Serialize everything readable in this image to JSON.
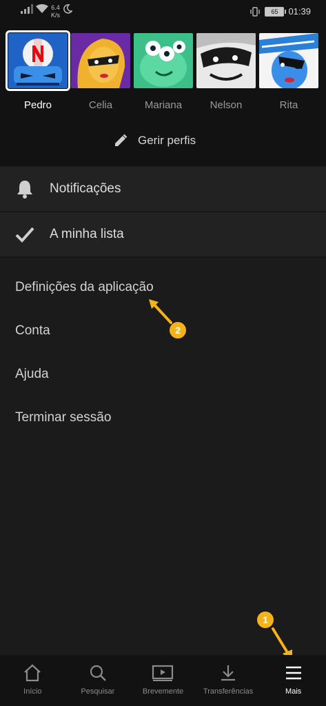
{
  "status_bar": {
    "net_speed_value": "6.4",
    "net_speed_unit": "K/s",
    "battery": "65",
    "time": "01:39"
  },
  "profiles": [
    {
      "name": "Pedro",
      "selected": true
    },
    {
      "name": "Celia",
      "selected": false
    },
    {
      "name": "Mariana",
      "selected": false
    },
    {
      "name": "Nelson",
      "selected": false
    },
    {
      "name": "Rita",
      "selected": false
    }
  ],
  "manage_profiles_label": "Gerir perfis",
  "menu": {
    "notifications_label": "Notificações",
    "my_list_label": "A minha lista"
  },
  "links": {
    "app_settings": "Definições da aplicação",
    "account": "Conta",
    "help": "Ajuda",
    "sign_out": "Terminar sessão"
  },
  "annotations": {
    "badge_1": "1",
    "badge_2": "2"
  },
  "bottom_nav": {
    "home": "Início",
    "search": "Pesquisar",
    "coming_soon": "Brevemente",
    "downloads": "Transferências",
    "more": "Mais"
  },
  "colors": {
    "accent_badge": "#f5b21b",
    "netflix_red": "#e50914",
    "background": "#1b1b1b"
  }
}
